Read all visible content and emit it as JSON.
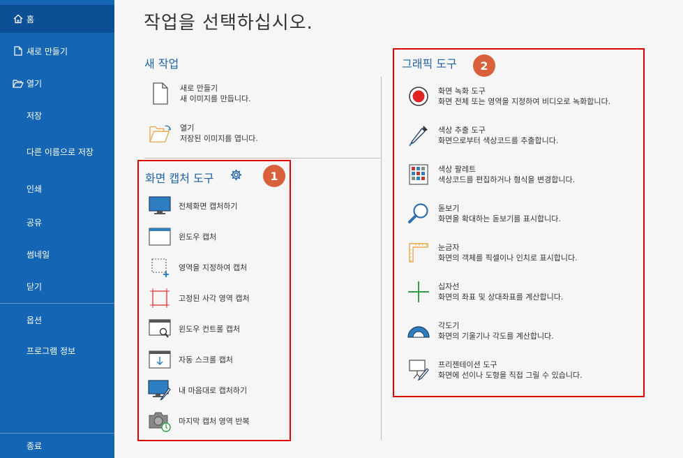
{
  "sidebar": {
    "items": [
      {
        "label": "홈",
        "icon": "home-icon"
      },
      {
        "label": "새로 만들기",
        "icon": "new-file-icon"
      },
      {
        "label": "열기",
        "icon": "open-folder-icon"
      },
      {
        "label": "저장"
      },
      {
        "label": "다른 이름으로 저장"
      },
      {
        "label": "인쇄"
      },
      {
        "label": "공유"
      },
      {
        "label": "썸네일"
      },
      {
        "label": "닫기"
      },
      {
        "label": "옵션"
      },
      {
        "label": "프로그램 정보"
      },
      {
        "label": "종료"
      }
    ]
  },
  "main": {
    "title": "작업을 선택하십시오.",
    "new_task": {
      "title": "새 작업",
      "items": [
        {
          "title": "새로 만들기",
          "desc": "새 이미지를 만듭니다."
        },
        {
          "title": "열기",
          "desc": "저장된 이미지를 엽니다."
        }
      ]
    },
    "capture_tools": {
      "title": "화면 캡처 도구",
      "badge": "1",
      "items": [
        {
          "label": "전체화면 캡처하기",
          "icon": "monitor-icon"
        },
        {
          "label": "윈도우 캡처",
          "icon": "window-icon"
        },
        {
          "label": "영역을 지정하여 캡처",
          "icon": "region-select-icon"
        },
        {
          "label": "고정된 사각 영역 캡처",
          "icon": "fixed-rect-icon"
        },
        {
          "label": "윈도우 컨트롤 캡처",
          "icon": "window-control-icon"
        },
        {
          "label": "자동 스크롤 캡처",
          "icon": "scroll-capture-icon"
        },
        {
          "label": "내 마음대로 캡처하기",
          "icon": "freehand-capture-icon"
        },
        {
          "label": "마지막 캡처 영역 반복",
          "icon": "repeat-capture-icon"
        }
      ]
    },
    "graphic_tools": {
      "title": "그래픽 도구",
      "badge": "2",
      "items": [
        {
          "title": "화면 녹화 도구",
          "desc": "화면 전체 또는 영역을 지정하여 비디오로 녹화합니다.",
          "icon": "record-icon"
        },
        {
          "title": "색상 추출 도구",
          "desc": "화면으로부터 색상코드를 추출합니다.",
          "icon": "eyedropper-icon"
        },
        {
          "title": "색상 팔레트",
          "desc": "색상코드를 편집하거나 형식을 변경합니다.",
          "icon": "palette-icon"
        },
        {
          "title": "돋보기",
          "desc": "화면을 확대하는 돋보기를 표시합니다.",
          "icon": "magnifier-icon"
        },
        {
          "title": "눈금자",
          "desc": "화면의 객체를 픽셀이나 인치로 표시합니다.",
          "icon": "ruler-icon"
        },
        {
          "title": "십자선",
          "desc": "화면의 좌표 및 상대좌표를 계산합니다.",
          "icon": "crosshair-icon"
        },
        {
          "title": "각도기",
          "desc": "화면의 기울기나 각도를 계산합니다.",
          "icon": "protractor-icon"
        },
        {
          "title": "프리젠테이션 도구",
          "desc": "화면에 선이나 도형을 직접 그릴 수 있습니다.",
          "icon": "presentation-icon"
        }
      ]
    }
  },
  "colors": {
    "sidebar": "#1565b5",
    "sidebar_active": "#0d4f94",
    "accent_text": "#1f63a8",
    "highlight": "#e00000",
    "badge": "#d9603b"
  }
}
